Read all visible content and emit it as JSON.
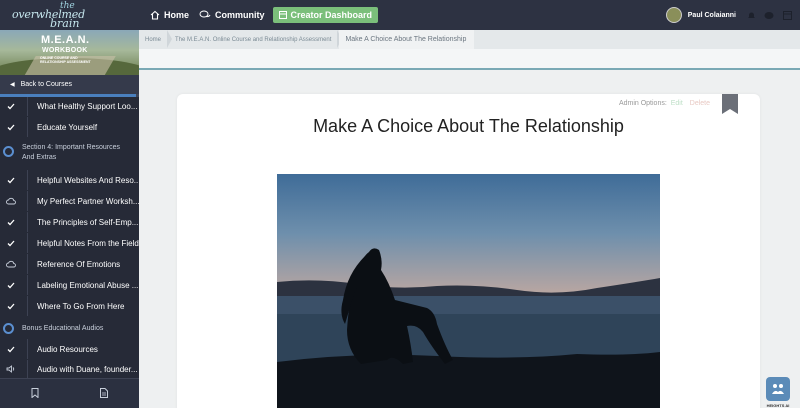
{
  "header": {
    "logo_the": "the",
    "logo_overwhelmed": "overwhelmed",
    "logo_brain": "brain",
    "nav": [
      {
        "label": "Home",
        "icon": "home-icon"
      },
      {
        "label": "Community",
        "icon": "chat-icon"
      }
    ],
    "creator_button": "Creator Dashboard",
    "user_name": "Paul Colaianni"
  },
  "sidebar": {
    "banner_title": "M.E.A.N.",
    "banner_subtitle": "WORKBOOK",
    "banner_caption": "ONLINE COURSE AND RELATIONSHIP ASSESSMENT",
    "back_label": "Back to Courses",
    "items": [
      {
        "label": "What Healthy Support Loo...",
        "icon": "check-icon"
      },
      {
        "label": "Educate Yourself",
        "icon": "check-icon"
      },
      {
        "label": "Helpful Websites And Reso...",
        "icon": "check-icon"
      },
      {
        "label": "My Perfect Partner Worksh...",
        "icon": "cloud-download-icon"
      },
      {
        "label": "The Principles of Self-Emp...",
        "icon": "check-icon"
      },
      {
        "label": "Helpful Notes From the Field",
        "icon": "check-icon"
      },
      {
        "label": "Reference Of Emotions",
        "icon": "cloud-download-icon"
      },
      {
        "label": "Labeling Emotional Abuse ...",
        "icon": "check-icon"
      },
      {
        "label": "Where To Go From Here",
        "icon": "check-icon"
      },
      {
        "label": "Audio Resources",
        "icon": "check-icon"
      },
      {
        "label": "Audio with Duane, founder...",
        "icon": "speaker-icon"
      }
    ],
    "sections": [
      {
        "label": "Section 4: Important Resources And Extras"
      },
      {
        "label": "Bonus Educational Audios"
      }
    ]
  },
  "breadcrumb": [
    "Home",
    "The M.E.A.N. Online Course and Relationship Assessment",
    "Make A Choice About The Relationship"
  ],
  "lesson": {
    "admin_label": "Admin Options:",
    "edit_label": "Edit",
    "delete_label": "Delete",
    "title": "Make A Choice About The Relationship"
  },
  "widget": {
    "label": "HEIGHTS AI"
  }
}
